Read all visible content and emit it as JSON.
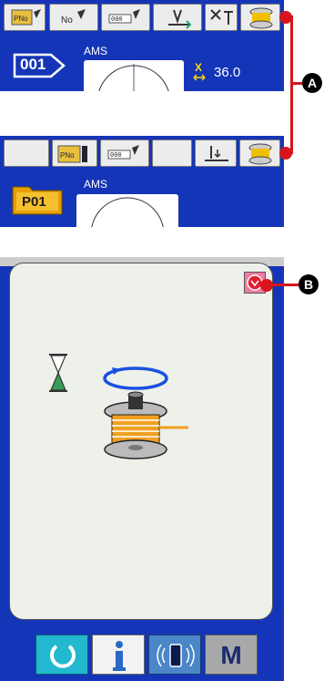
{
  "screen_a": {
    "ams_label": "AMS",
    "pattern_number": "001",
    "x_label": "X",
    "x_value": "36.0",
    "toolbar_icons": [
      "pattern-number-icon",
      "no-edit-icon",
      "counter-edit-icon",
      "presser-icon",
      "thread-tension-icon",
      "bobbin-winder-icon"
    ]
  },
  "screen_b": {
    "ams_label": "AMS",
    "folder_label": "P01",
    "toolbar_icons": [
      "blank",
      "pattern-number-icon",
      "counter-edit-icon",
      "blank",
      "presser-down-icon",
      "bobbin-winder-icon"
    ]
  },
  "dialog": {
    "icons": [
      "stop-icon",
      "hourglass-icon",
      "rotation-arrow-icon",
      "bobbin-icon"
    ]
  },
  "bottom_bar": {
    "icons": [
      "ready-icon",
      "info-icon",
      "communication-icon"
    ],
    "mode_label": "M"
  },
  "callouts": {
    "a": "A",
    "b": "B"
  },
  "colors": {
    "panel": "#1535b8",
    "callout": "#d8141c",
    "dialog": "#eef1ea",
    "bobbin": "#f0a020"
  }
}
